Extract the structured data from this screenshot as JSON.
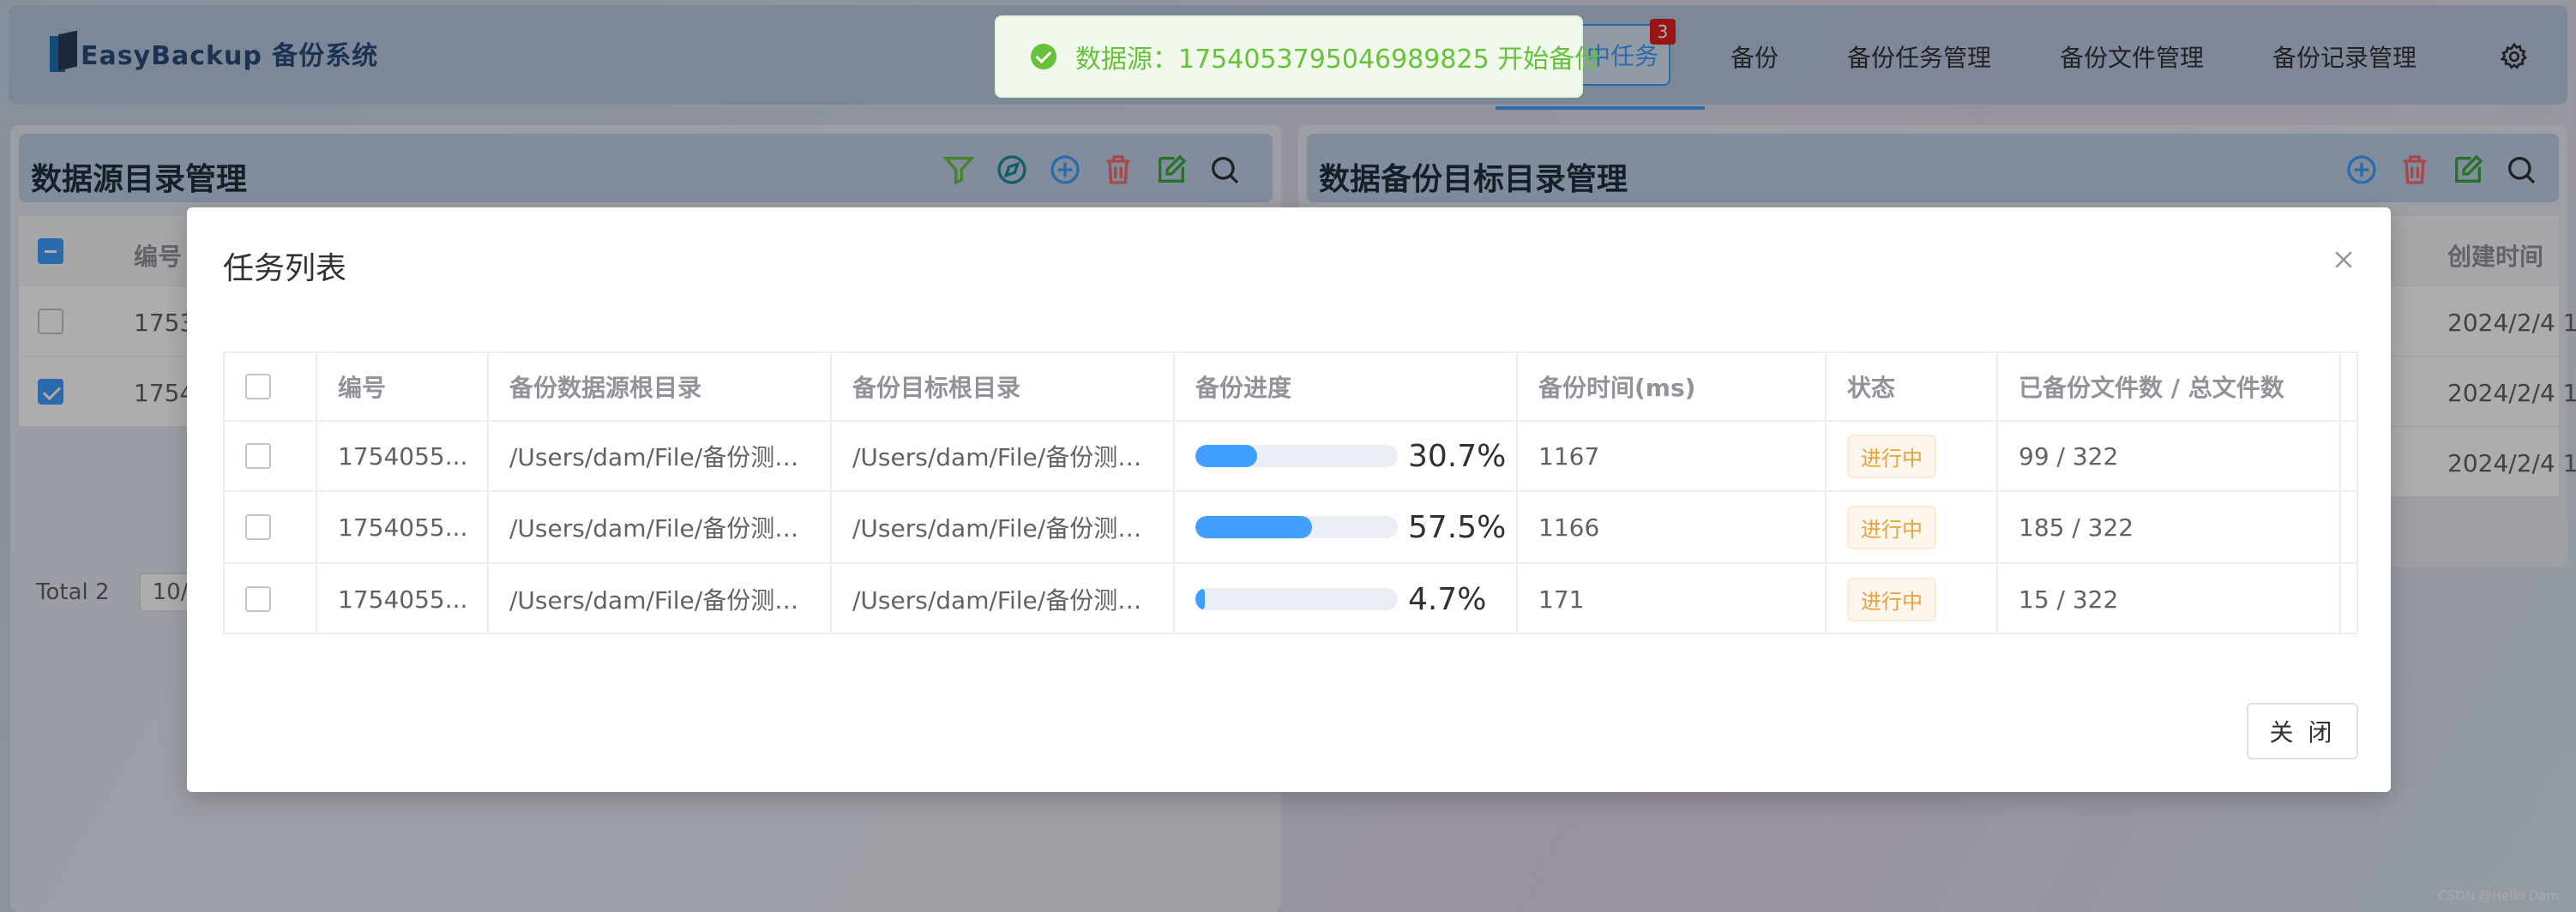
{
  "app": {
    "logo_text": "EasyBackup 备份系统"
  },
  "nav": {
    "task_button": "中任务",
    "task_badge": "3",
    "items": [
      "备份",
      "备份任务管理",
      "备份文件管理",
      "备份记录管理"
    ]
  },
  "left_panel": {
    "title": "数据源目录管理",
    "columns": [
      "编号"
    ],
    "rows": [
      {
        "id": "1753",
        "checked": false
      },
      {
        "id": "1754",
        "checked": true
      }
    ],
    "pager_total": "Total 2",
    "pager_size": "10/page"
  },
  "right_panel": {
    "title": "数据备份目标目录管理",
    "columns": [
      "创建时间"
    ],
    "rows": [
      "2024/2/4 1",
      "2024/2/4 1",
      "2024/2/4 1"
    ]
  },
  "toast": {
    "text": "数据源：1754053795046989825 开始备份",
    "color": "#67c23a"
  },
  "dialog": {
    "title": "任务列表",
    "close_button": "关 闭",
    "columns": [
      "编号",
      "备份数据源根目录",
      "备份目标根目录",
      "备份进度",
      "备份时间(ms)",
      "状态",
      "已备份文件数 / 总文件数"
    ],
    "rows": [
      {
        "id": "1754055...",
        "source": "/Users/dam/File/备份测试...",
        "target": "/Users/dam/File/备份测试...",
        "progress": 30.7,
        "progress_label": "30.7%",
        "time_ms": "1167",
        "status": "进行中",
        "files": "99 / 322"
      },
      {
        "id": "1754055...",
        "source": "/Users/dam/File/备份测试...",
        "target": "/Users/dam/File/备份测试...",
        "progress": 57.5,
        "progress_label": "57.5%",
        "time_ms": "1166",
        "status": "进行中",
        "files": "185 / 322"
      },
      {
        "id": "1754055...",
        "source": "/Users/dam/File/备份测试...",
        "target": "/Users/dam/File/备份测试...",
        "progress": 4.7,
        "progress_label": "4.7%",
        "time_ms": "171",
        "status": "进行中",
        "files": "15 / 322"
      }
    ]
  },
  "watermark": "CSDN @Hello Dam",
  "colors": {
    "primary": "#409eff",
    "success": "#67c23a",
    "warning": "#e6a23c",
    "danger": "#f56c6c"
  }
}
